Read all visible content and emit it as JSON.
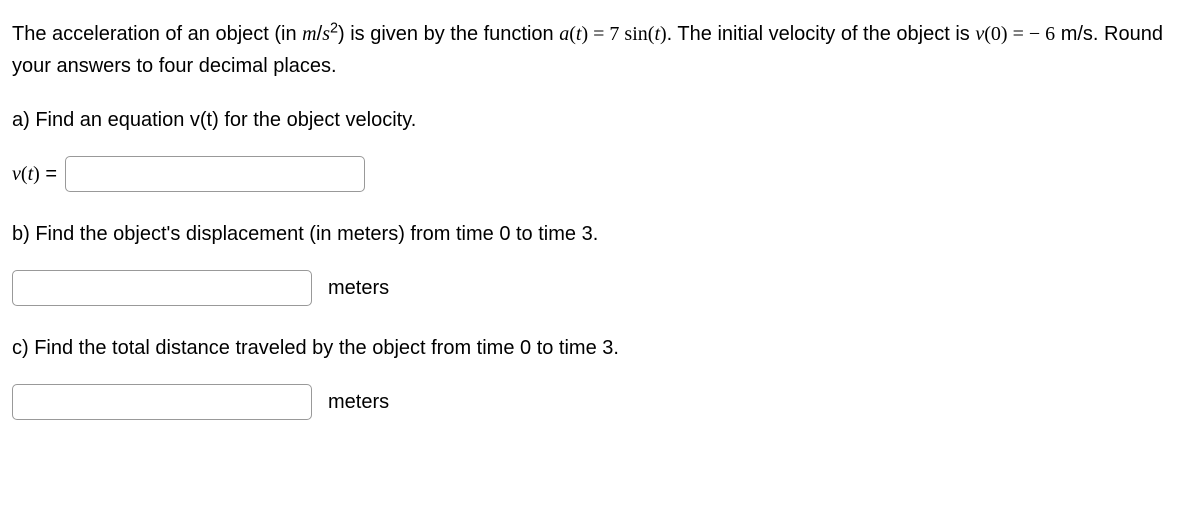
{
  "problem": {
    "intro_pre": "The acceleration of an object (in ",
    "unit_m": "m",
    "unit_slash": "/",
    "unit_s": "s",
    "unit_exp": "2",
    "intro_mid": ") is given by the function ",
    "func_a": "a",
    "paren_open": "(",
    "var_t": "t",
    "paren_close": ")",
    "eq": " = ",
    "coef7": "7 ",
    "sin": "sin",
    "intro_post": ". The initial velocity of the object is ",
    "func_v": "v",
    "zero": "0",
    "neg6": " − 6",
    "ms": " m/s. Round your answers to four decimal places."
  },
  "parts": {
    "a": {
      "text": "a) Find an equation v(t) for the object velocity.",
      "label_v": "v",
      "label_open": "(",
      "label_t": "t",
      "label_close": ")",
      "label_eq": " = "
    },
    "b": {
      "text": "b) Find the object's displacement (in meters) from time 0 to time 3.",
      "unit": "meters"
    },
    "c": {
      "text": "c) Find the total distance traveled by the object from time 0 to time 3.",
      "unit": "meters"
    }
  }
}
